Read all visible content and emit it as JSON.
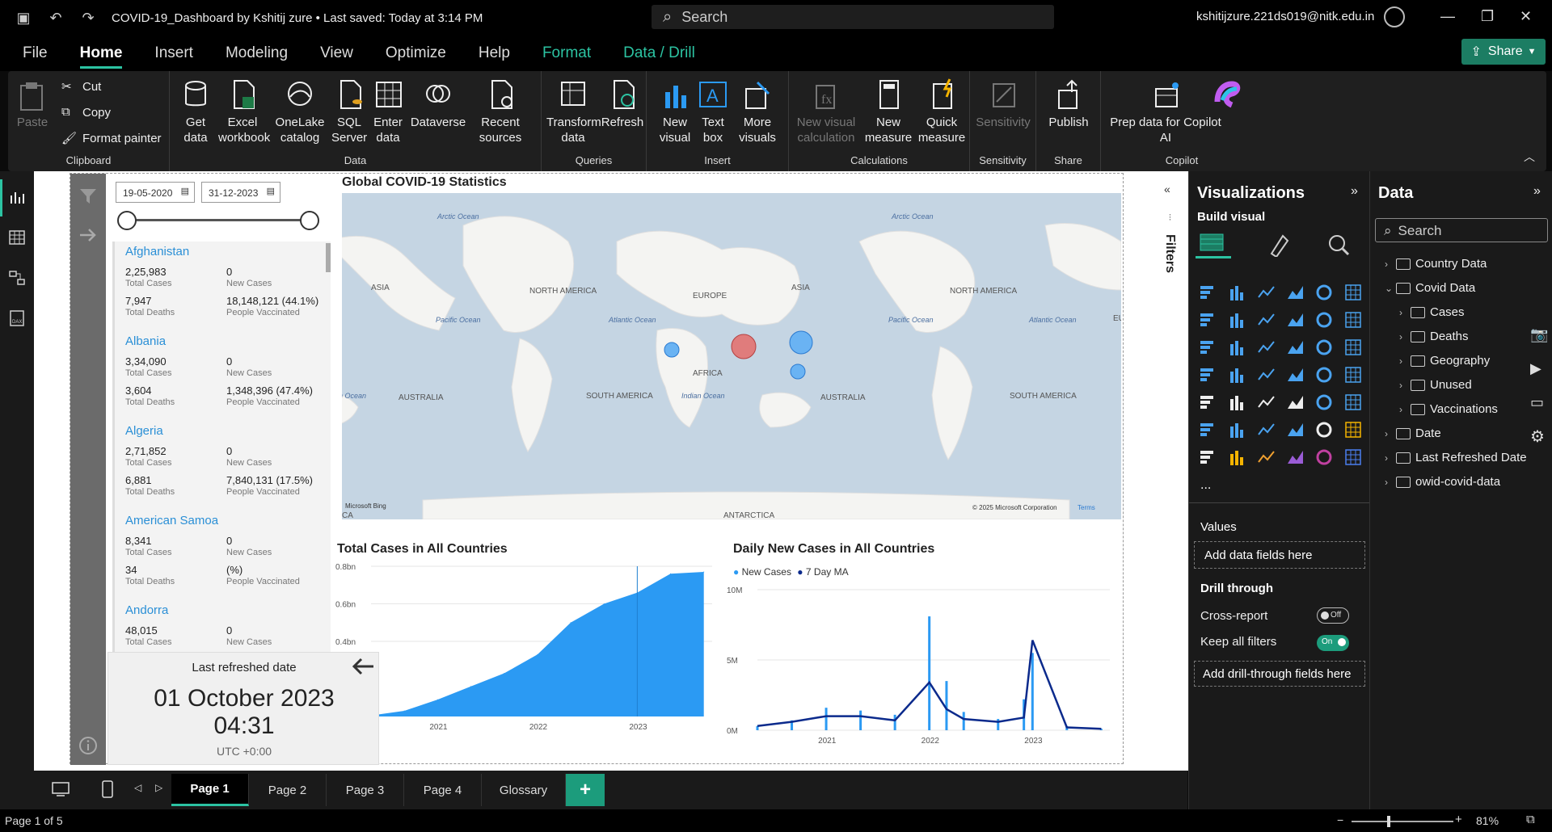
{
  "titlebar": {
    "doc_title": "COVID-19_Dashboard by Kshitij zure  •  Last saved: Today at 3:14 PM",
    "search_placeholder": "Search",
    "account": "kshitijzure.221ds019@nitk.edu.in"
  },
  "menu": {
    "items": [
      "File",
      "Home",
      "Insert",
      "Modeling",
      "View",
      "Optimize",
      "Help",
      "Format",
      "Data / Drill"
    ],
    "active": "Home",
    "share_label": "Share"
  },
  "ribbon": {
    "clipboard": {
      "paste": "Paste",
      "cut": "Cut",
      "copy": "Copy",
      "format_painter": "Format painter",
      "label": "Clipboard"
    },
    "data": {
      "get_data": "Get data",
      "excel": "Excel workbook",
      "onelake": "OneLake catalog",
      "sql": "SQL Server",
      "enter": "Enter data",
      "dataverse": "Dataverse",
      "recent": "Recent sources",
      "label": "Data"
    },
    "queries": {
      "transform": "Transform data",
      "refresh": "Refresh",
      "label": "Queries"
    },
    "insert": {
      "new_visual": "New visual",
      "text_box": "Text box",
      "more_visuals": "More visuals",
      "label": "Insert"
    },
    "calculations": {
      "new_visual_calc": "New visual calculation",
      "new_measure": "New measure",
      "quick_measure": "Quick measure",
      "label": "Calculations"
    },
    "sensitivity": {
      "sensitivity": "Sensitivity",
      "label": "Sensitivity"
    },
    "share": {
      "publish": "Publish",
      "label": "Share"
    },
    "copilot": {
      "prep": "Prep data for Copilot AI",
      "label": "Copilot"
    }
  },
  "report": {
    "date_from": "19-05-2020",
    "date_to": "31-12-2023",
    "countries": [
      {
        "name": "Afghanistan",
        "total_cases": "2,25,983",
        "new_cases": "0",
        "total_deaths": "7,947",
        "vaccinated": "18,148,121 (44.1%)"
      },
      {
        "name": "Albania",
        "total_cases": "3,34,090",
        "new_cases": "0",
        "total_deaths": "3,604",
        "vaccinated": "1,348,396 (47.4%)"
      },
      {
        "name": "Algeria",
        "total_cases": "2,71,852",
        "new_cases": "0",
        "total_deaths": "6,881",
        "vaccinated": "7,840,131 (17.5%)"
      },
      {
        "name": "American Samoa",
        "total_cases": "8,341",
        "new_cases": "0",
        "total_deaths": "34",
        "vaccinated": "(%)"
      },
      {
        "name": "Andorra",
        "total_cases": "48,015",
        "new_cases": "0",
        "total_deaths": "",
        "vaccinated": ""
      }
    ],
    "labels": {
      "total_cases": "Total Cases",
      "new_cases": "New Cases",
      "total_deaths": "Total Deaths",
      "people_vaccinated": "People Vaccinated"
    },
    "map": {
      "title": "Global COVID-19 Statistics",
      "places": [
        "Arctic Ocean",
        "Arctic Ocean",
        "ASIA",
        "NORTH AMERICA",
        "EUROPE",
        "ASIA",
        "NORTH AMERICA",
        "Pacific Ocean",
        "Atlantic Ocean",
        "Pacific Ocean",
        "Atlantic Ocean",
        "AFRICA",
        "SOUTH AMERICA",
        "Indian Ocean",
        "AUSTRALIA",
        "AUSTRALIA",
        "SOUTH AMERICA",
        "ANTARCTICA",
        "n Ocean",
        "CA",
        "EU"
      ],
      "copyright": "© 2025 Microsoft Corporation",
      "terms": "Terms",
      "bing": "Microsoft Bing"
    },
    "refresh": {
      "label": "Last refreshed date",
      "date": "01 October 2023",
      "time": "04:31",
      "tz": "UTC +0:00"
    }
  },
  "chart_data": [
    {
      "type": "area",
      "title": "Total Cases in All Countries",
      "x": [
        "2020-05",
        "2020-09",
        "2021-01",
        "2021-05",
        "2021-09",
        "2022-01",
        "2022-05",
        "2022-09",
        "2023-01",
        "2023-05",
        "2023-09"
      ],
      "series": [
        {
          "values": [
            0.005,
            0.03,
            0.09,
            0.16,
            0.23,
            0.33,
            0.5,
            0.6,
            0.66,
            0.76,
            0.77
          ]
        }
      ],
      "y_ticks": [
        "0.8bn",
        "0.6bn",
        "0.4bn"
      ],
      "x_ticks": [
        "2021",
        "2022",
        "2023"
      ],
      "color": "#2b9af3"
    },
    {
      "type": "bar",
      "title": "Daily New Cases in All Countries",
      "legend": [
        "New Cases",
        "7 Day MA"
      ],
      "x": [
        "2020-05",
        "2020-09",
        "2021-01",
        "2021-05",
        "2021-09",
        "2022-01",
        "2022-03",
        "2022-05",
        "2022-09",
        "2022-12",
        "2023-01",
        "2023-05",
        "2023-09"
      ],
      "series": [
        {
          "name": "New Cases",
          "values": [
            0.3,
            0.7,
            1.6,
            1.4,
            1.1,
            8.1,
            3.5,
            1.3,
            0.8,
            2.2,
            5.5,
            0.3,
            0.1
          ]
        },
        {
          "name": "7 Day MA",
          "values": [
            0.3,
            0.6,
            1.0,
            1.0,
            0.7,
            3.4,
            1.5,
            0.8,
            0.6,
            0.9,
            6.4,
            0.2,
            0.1
          ]
        }
      ],
      "y_ticks": [
        "10M",
        "5M",
        "0M"
      ],
      "x_ticks": [
        "2021",
        "2022",
        "2023"
      ],
      "colors": [
        "#2b9af3",
        "#0b2a8c"
      ]
    }
  ],
  "filters": {
    "label": "Filters"
  },
  "viz": {
    "title": "Visualizations",
    "build": "Build visual",
    "values": "Values",
    "add_fields": "Add data fields here",
    "drill": "Drill through",
    "cross_report": "Cross-report",
    "off": "Off",
    "keep_filters": "Keep all filters",
    "on": "On",
    "add_drill": "Add drill-through fields here",
    "more": "..."
  },
  "data_pane": {
    "title": "Data",
    "search": "Search",
    "tree": [
      "Country Data",
      "Covid Data",
      "Cases",
      "Deaths",
      "Geography",
      "Unused",
      "Vaccinations",
      "Date",
      "Last Refreshed Date",
      "owid-covid-data"
    ]
  },
  "pages": [
    "Page 1",
    "Page 2",
    "Page 3",
    "Page 4",
    "Glossary"
  ],
  "status": {
    "page": "Page 1 of 5",
    "zoom": "81%"
  }
}
